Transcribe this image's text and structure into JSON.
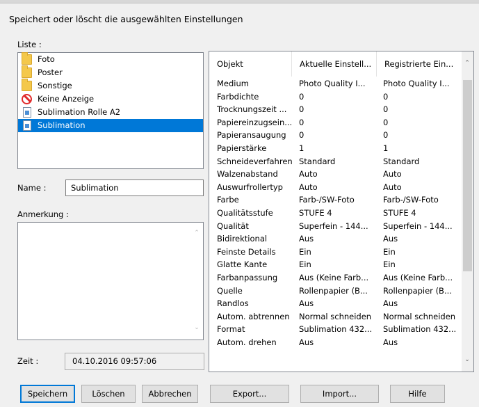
{
  "dialog": {
    "description": "Speichert oder löscht die ausgewählten Einstellungen"
  },
  "list": {
    "label": "Liste :",
    "items": [
      {
        "label": "Foto",
        "icon": "folder-icon",
        "selected": false
      },
      {
        "label": "Poster",
        "icon": "folder-icon",
        "selected": false
      },
      {
        "label": "Sonstige",
        "icon": "folder-icon",
        "selected": false
      },
      {
        "label": "Keine Anzeige",
        "icon": "no-entry-icon",
        "selected": false
      },
      {
        "label": "Sublimation Rolle A2",
        "icon": "document-icon",
        "selected": false
      },
      {
        "label": "Sublimation",
        "icon": "document-icon",
        "selected": true
      }
    ]
  },
  "name": {
    "label": "Name :",
    "value": "Sublimation"
  },
  "note": {
    "label": "Anmerkung :",
    "value": ""
  },
  "time": {
    "label": "Zeit :",
    "value": "04.10.2016 09:57:06"
  },
  "table": {
    "columns": [
      "Objekt",
      "Aktuelle Einstell...",
      "Registrierte Ein..."
    ],
    "rows": [
      [
        "Medium",
        "Photo Quality I...",
        "Photo Quality I..."
      ],
      [
        "Farbdichte",
        "0",
        "0"
      ],
      [
        "Trocknungszeit ...",
        "0",
        "0"
      ],
      [
        "Papiereinzugsein...",
        "0",
        "0"
      ],
      [
        "Papieransaugung",
        "0",
        "0"
      ],
      [
        "Papierstärke",
        "1",
        "1"
      ],
      [
        "Schneideverfahren",
        "Standard",
        "Standard"
      ],
      [
        "Walzenabstand",
        "Auto",
        "Auto"
      ],
      [
        "Auswurfrollertyp",
        "Auto",
        "Auto"
      ],
      [
        "Farbe",
        "Farb-/SW-Foto",
        "Farb-/SW-Foto"
      ],
      [
        "Qualitätsstufe",
        "STUFE 4",
        "STUFE 4"
      ],
      [
        "Qualität",
        "Superfein - 144...",
        "Superfein - 144..."
      ],
      [
        "Bidirektional",
        "Aus",
        "Aus"
      ],
      [
        "Feinste Details",
        "Ein",
        "Ein"
      ],
      [
        "Glatte Kante",
        "Ein",
        "Ein"
      ],
      [
        "Farbanpassung",
        "Aus (Keine Farb...",
        "Aus (Keine Farb..."
      ],
      [
        "Quelle",
        "Rollenpapier (B...",
        "Rollenpapier (B..."
      ],
      [
        "Randlos",
        "Aus",
        "Aus"
      ],
      [
        "Autom. abtrennen",
        "Normal schneiden",
        "Normal schneiden"
      ],
      [
        "Format",
        "Sublimation 432...",
        "Sublimation 432..."
      ],
      [
        "Autom. drehen",
        "Aus",
        "Aus"
      ]
    ]
  },
  "buttons": {
    "save": "Speichern",
    "delete": "Löschen",
    "cancel": "Abbrechen",
    "export": "Export...",
    "import": "Import...",
    "help": "Hilfe"
  },
  "colors": {
    "selection": "#0078d7",
    "dialog_bg": "#f0f0f0",
    "folder": "#f4c84b",
    "no_entry": "#e02a2a"
  }
}
